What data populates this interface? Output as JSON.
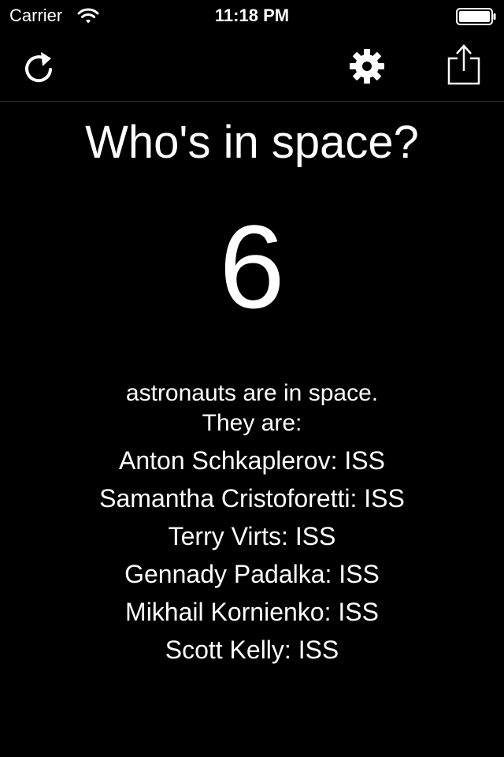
{
  "status_bar": {
    "carrier": "Carrier",
    "time": "11:18 PM",
    "icons": [
      "wifi-icon",
      "battery-icon"
    ]
  },
  "nav_bar": {
    "buttons": [
      {
        "name": "refresh",
        "icon": "refresh-icon"
      },
      {
        "name": "settings",
        "icon": "gear-icon"
      },
      {
        "name": "share",
        "icon": "share-icon"
      }
    ]
  },
  "main": {
    "title": "Who's in space?",
    "count": "6",
    "description_line1": "astronauts are in space.",
    "description_line2": "They are:",
    "astronauts": [
      "Anton Schkaplerov: ISS",
      "Samantha Cristoforetti: ISS",
      "Terry Virts: ISS",
      "Gennady Padalka: ISS",
      "Mikhail Kornienko: ISS",
      "Scott Kelly: ISS"
    ]
  },
  "colors": {
    "background": "#000000",
    "text": "#ffffff"
  }
}
